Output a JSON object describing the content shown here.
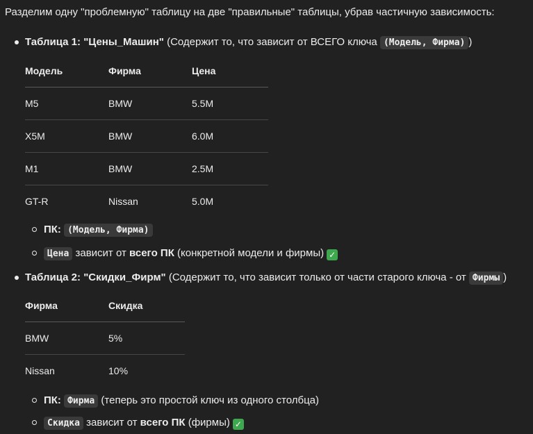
{
  "intro": "Разделим одну \"проблемную\" таблицу на две \"правильные\" таблицы, убрав частичную зависимость:",
  "table1": {
    "title": "Таблица 1: \"Цены_Машин\"",
    "desc_before": " (Содержит то, что зависит от ВСЕГО ключа ",
    "code": "(Модель, Фирма)",
    "desc_after": ")",
    "headers": [
      "Модель",
      "Фирма",
      "Цена"
    ],
    "rows": [
      [
        "M5",
        "BMW",
        "5.5M"
      ],
      [
        "X5M",
        "BMW",
        "6.0M"
      ],
      [
        "M1",
        "BMW",
        "2.5M"
      ],
      [
        "GT-R",
        "Nissan",
        "5.0M"
      ]
    ],
    "pk_label": "ПК:",
    "pk_code": "(Модель, Фирма)",
    "dep_code": "Цена",
    "dep_text1": " зависит от ",
    "dep_bold": "всего ПК",
    "dep_text2": " (конкретной модели и фирмы)",
    "check": "✓"
  },
  "table2": {
    "title": "Таблица 2: \"Скидки_Фирм\"",
    "desc_before": " (Содержит то, что зависит только от части старого ключа - от ",
    "code": "Фирмы",
    "desc_after": ")",
    "headers": [
      "Фирма",
      "Скидка"
    ],
    "rows": [
      [
        "BMW",
        "5%"
      ],
      [
        "Nissan",
        "10%"
      ]
    ],
    "pk_label": "ПК:",
    "pk_code": "Фирма",
    "pk_text": " (теперь это простой ключ из одного столбца)",
    "dep_code": "Скидка",
    "dep_text1": " зависит от ",
    "dep_bold": "всего ПК",
    "dep_text2": " (фирмы)",
    "check": "✓"
  }
}
